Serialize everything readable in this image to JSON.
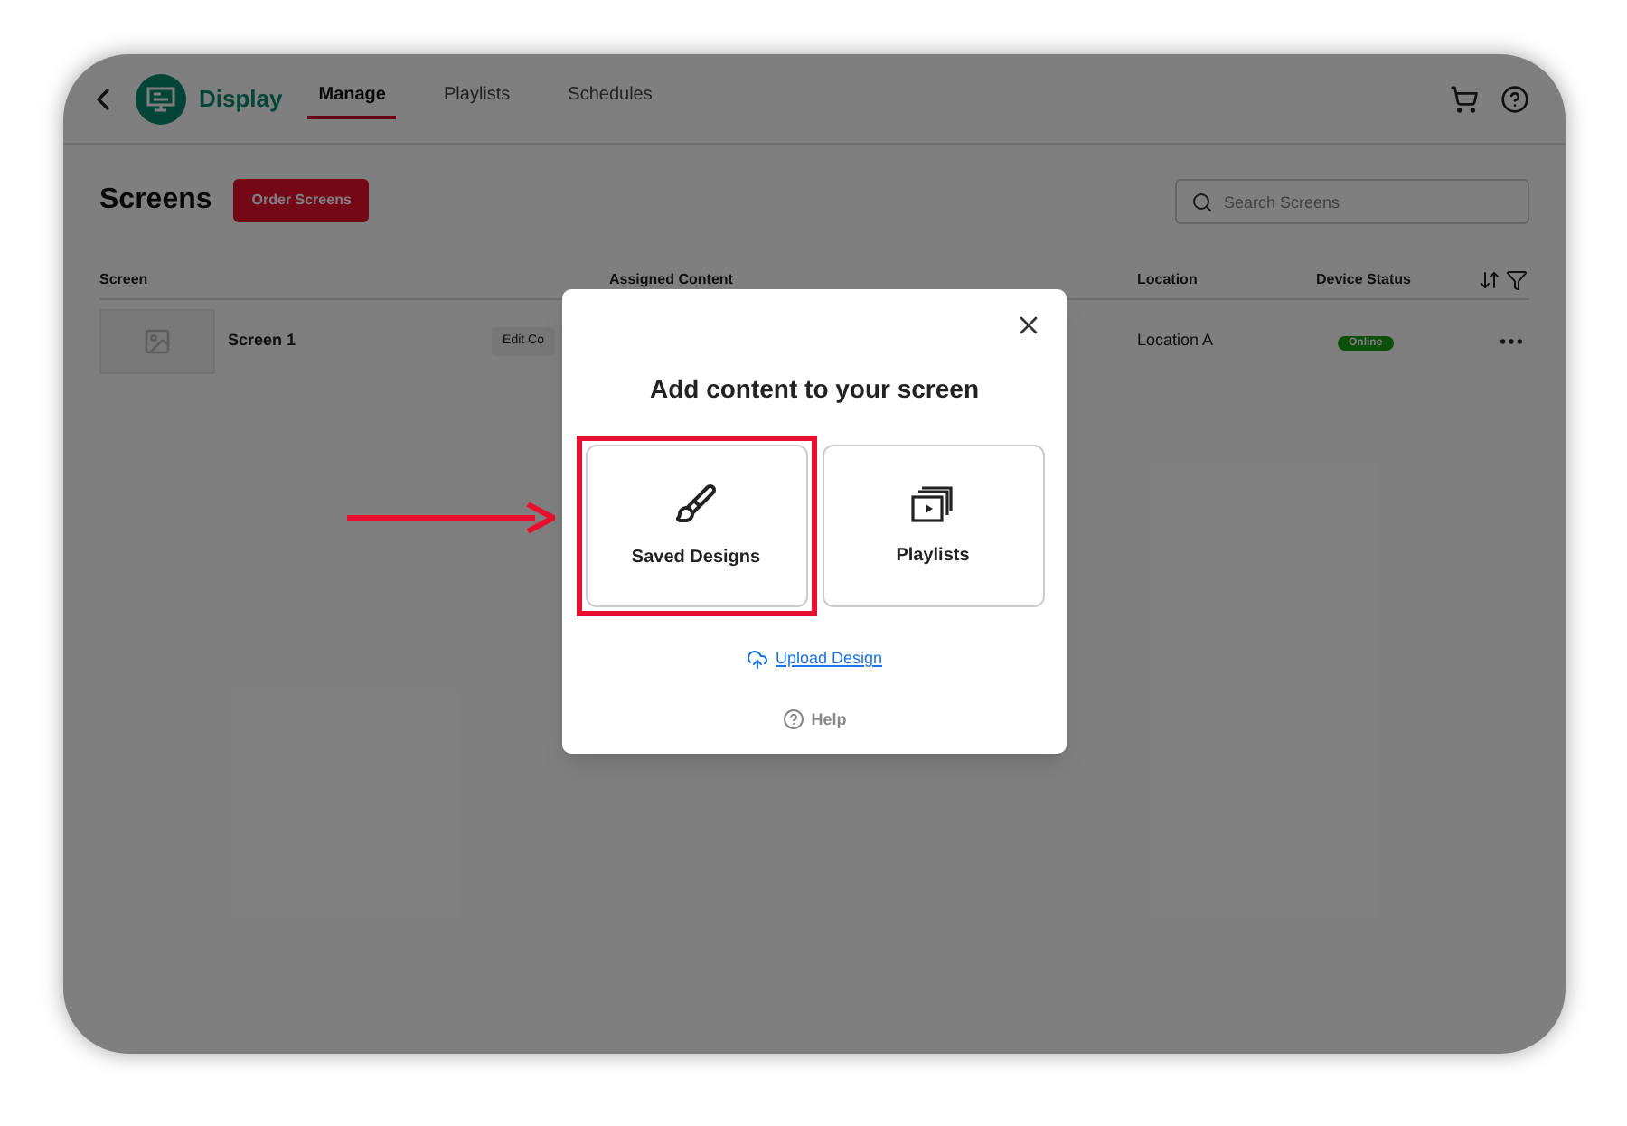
{
  "header": {
    "app_name": "Display",
    "tabs": [
      {
        "label": "Manage",
        "selected": true
      },
      {
        "label": "Playlists",
        "selected": false
      },
      {
        "label": "Schedules",
        "selected": false
      }
    ]
  },
  "page": {
    "title": "Screens",
    "order_button": "Order Screens",
    "search": {
      "placeholder": "Search Screens"
    }
  },
  "table": {
    "columns": [
      "Screen",
      "Assigned Content",
      "Location",
      "Device Status"
    ],
    "rows": [
      {
        "name": "Screen 1",
        "edit_button": "Edit Co",
        "location": "Location A",
        "status": "Online"
      }
    ]
  },
  "dialog": {
    "title": "Add content to your screen",
    "options": [
      {
        "label": "Saved Designs",
        "kind": "designs",
        "highlighted": true
      },
      {
        "label": "Playlists",
        "kind": "playlists",
        "highlighted": false
      }
    ],
    "upload_link": "Upload Design",
    "help": "Help"
  }
}
